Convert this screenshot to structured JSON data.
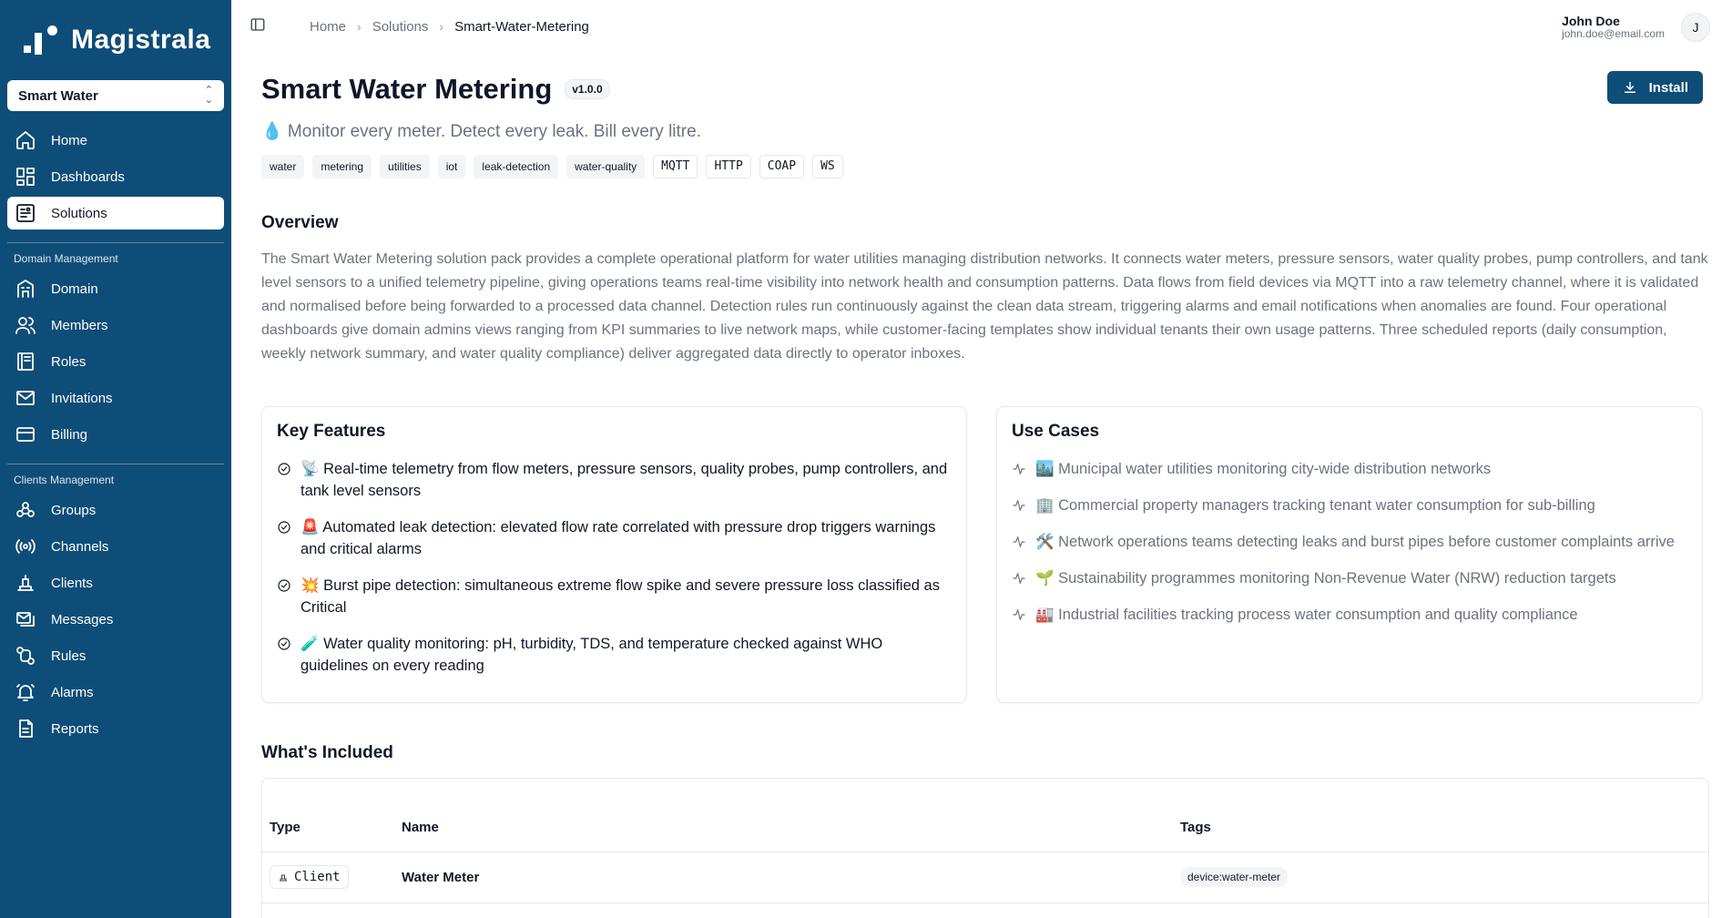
{
  "app": {
    "brand": "Magistrala"
  },
  "workspace_selector": {
    "value": "Smart Water"
  },
  "sidebar": {
    "main_items": [
      {
        "label": "Home",
        "icon": "home-icon"
      },
      {
        "label": "Dashboards",
        "icon": "dashboard-icon"
      },
      {
        "label": "Solutions",
        "icon": "solutions-icon",
        "active": true
      }
    ],
    "domain_section_label": "Domain Management",
    "domain_items": [
      {
        "label": "Domain",
        "icon": "domain-icon"
      },
      {
        "label": "Members",
        "icon": "members-icon"
      },
      {
        "label": "Roles",
        "icon": "roles-icon"
      },
      {
        "label": "Invitations",
        "icon": "mail-icon"
      },
      {
        "label": "Billing",
        "icon": "card-icon"
      }
    ],
    "clients_section_label": "Clients Management",
    "clients_items": [
      {
        "label": "Groups",
        "icon": "groups-icon"
      },
      {
        "label": "Channels",
        "icon": "channels-icon"
      },
      {
        "label": "Clients",
        "icon": "clients-icon"
      },
      {
        "label": "Messages",
        "icon": "messages-icon"
      },
      {
        "label": "Rules",
        "icon": "rules-icon"
      },
      {
        "label": "Alarms",
        "icon": "bell-icon"
      },
      {
        "label": "Reports",
        "icon": "report-icon"
      }
    ]
  },
  "breadcrumb": {
    "home": "Home",
    "solutions": "Solutions",
    "current": "Smart-Water-Metering"
  },
  "user": {
    "name": "John Doe",
    "email": "john.doe@email.com",
    "initial": "J"
  },
  "solution": {
    "title": "Smart Water Metering",
    "version": "v1.0.0",
    "install_label": "Install",
    "tagline": "💧 Monitor every meter. Detect every leak. Bill every litre.",
    "tags": [
      "water",
      "metering",
      "utilities",
      "iot",
      "leak-detection",
      "water-quality"
    ],
    "protocols": [
      "MQTT",
      "HTTP",
      "COAP",
      "WS"
    ],
    "overview_title": "Overview",
    "overview": "The Smart Water Metering solution pack provides a complete operational platform for water utilities managing distribution networks. It connects water meters, pressure sensors, water quality probes, pump controllers, and tank level sensors to a unified telemetry pipeline, giving operations teams real-time visibility into network health and consumption patterns. Data flows from field devices via MQTT into a raw telemetry channel, where it is validated and normalised before being forwarded to a processed data channel. Detection rules run continuously against the clean data stream, triggering alarms and email notifications when anomalies are found. Four operational dashboards give domain admins views ranging from KPI summaries to live network maps, while customer-facing templates show individual tenants their own usage patterns. Three scheduled reports (daily consumption, weekly network summary, and water quality compliance) deliver aggregated data directly to operator inboxes."
  },
  "key_features": {
    "title": "Key Features",
    "items": [
      "📡 Real-time telemetry from flow meters, pressure sensors, quality probes, pump controllers, and tank level sensors",
      "🚨 Automated leak detection: elevated flow rate correlated with pressure drop triggers warnings and critical alarms",
      "💥 Burst pipe detection: simultaneous extreme flow spike and severe pressure loss classified as Critical",
      "🧪 Water quality monitoring: pH, turbidity, TDS, and temperature checked against WHO guidelines on every reading"
    ]
  },
  "use_cases": {
    "title": "Use Cases",
    "items": [
      "🏙️ Municipal water utilities monitoring city-wide distribution networks",
      "🏢 Commercial property managers tracking tenant water consumption for sub-billing",
      "🛠️ Network operations teams detecting leaks and burst pipes before customer complaints arrive",
      "🌱 Sustainability programmes monitoring Non-Revenue Water (NRW) reduction targets",
      "🏭 Industrial facilities tracking process water consumption and quality compliance"
    ]
  },
  "included": {
    "title": "What's Included",
    "columns": {
      "type": "Type",
      "name": "Name",
      "tags": "Tags"
    },
    "rows": [
      {
        "type": "Client",
        "name": "Water Meter",
        "tag": "device:water-meter"
      }
    ]
  }
}
